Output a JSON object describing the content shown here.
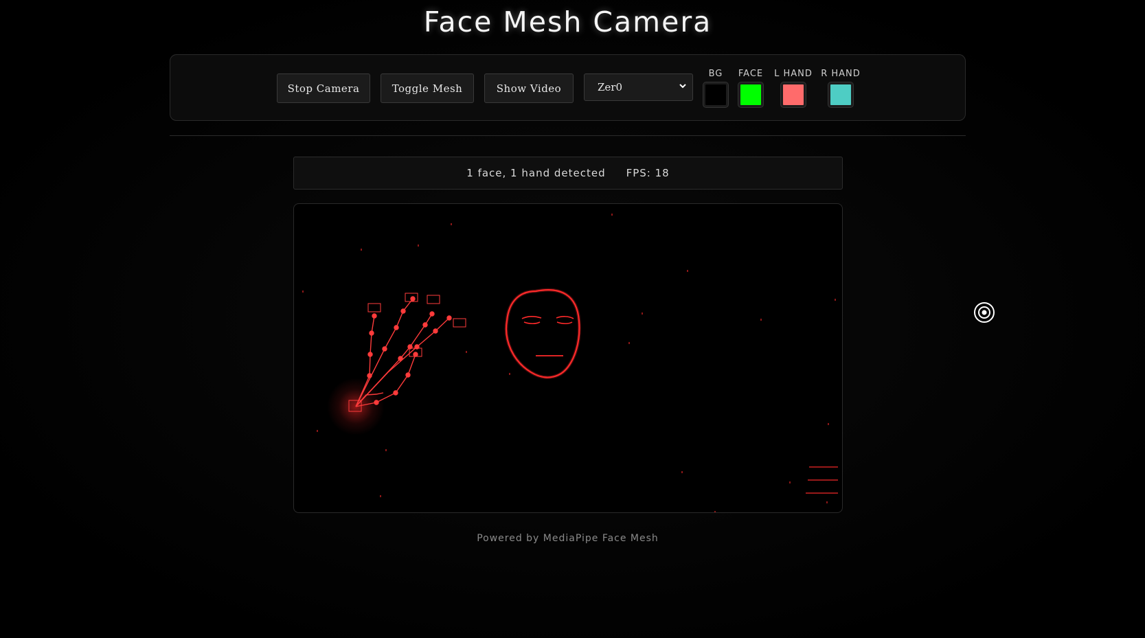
{
  "page": {
    "title": "Face Mesh Camera",
    "footer": "Powered by MediaPipe Face Mesh"
  },
  "toolbar": {
    "stop_label": "Stop Camera",
    "toggle_mesh_label": "Toggle Mesh",
    "show_video_label": "Show Video",
    "theme_select": {
      "selected": "Zer0"
    },
    "swatches": [
      {
        "label": "BG",
        "color": "#000000"
      },
      {
        "label": "FACE",
        "color": "#00ff00"
      },
      {
        "label": "L HAND",
        "color": "#ff6b6b"
      },
      {
        "label": "R HAND",
        "color": "#4ecdc4"
      }
    ]
  },
  "status": {
    "detection": "1 face, 1 hand detected",
    "fps": "FPS: 18"
  },
  "overlay": {
    "accent": "#ff2a2a",
    "side_icon": "target-icon"
  }
}
